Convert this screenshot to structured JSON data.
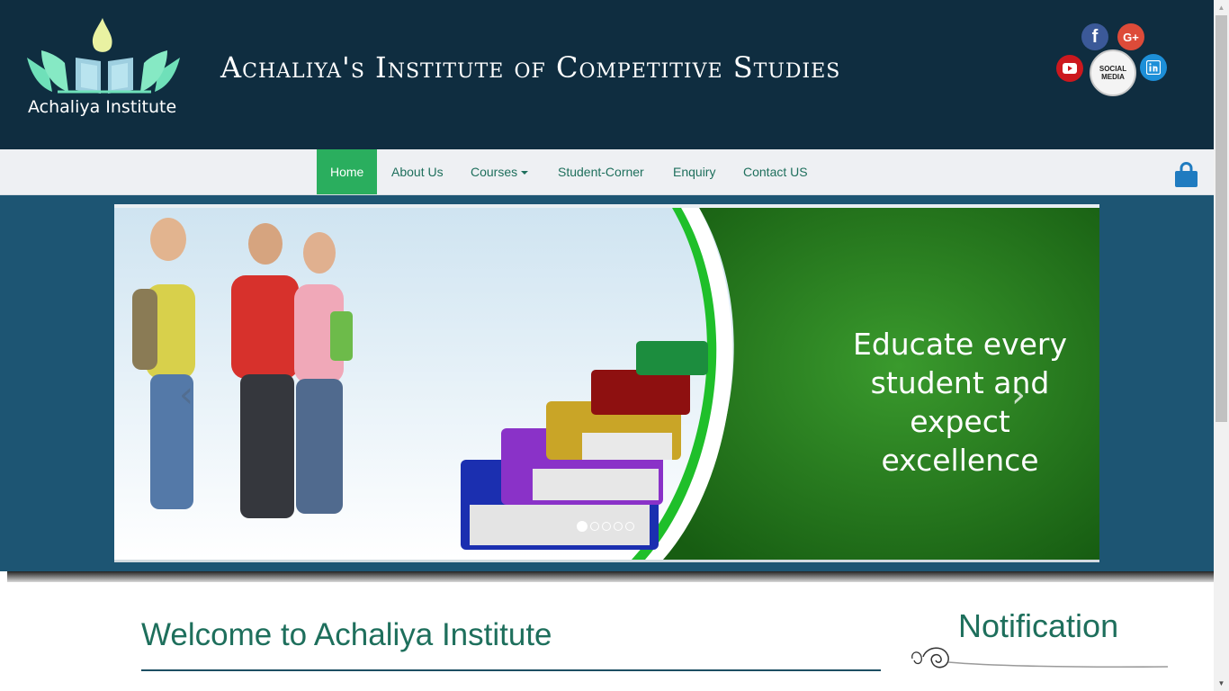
{
  "header": {
    "logo_text": "Achaliya Institute",
    "title": "Achaliya's Institute of Competitive Studies",
    "social": {
      "facebook": "f",
      "googleplus": "G+",
      "social_media_line1": "SOCIAL",
      "social_media_line2": "MEDIA"
    }
  },
  "nav": {
    "items": [
      {
        "label": "Home"
      },
      {
        "label": "About Us"
      },
      {
        "label": "Courses"
      },
      {
        "label": "Student-Corner"
      },
      {
        "label": "Enquiry"
      },
      {
        "label": "Contact US"
      }
    ],
    "active": "Home",
    "icons": [
      "cart-icon"
    ]
  },
  "carousel": {
    "slide_text": "Educate every student and expect excellence",
    "slide_count": 5,
    "current_slide": 1
  },
  "content": {
    "welcome_title": "Welcome to Achaliya Institute",
    "notification_title": "Notification"
  },
  "colors": {
    "header_bg": "#0f2d40",
    "nav_bg": "#eef0f3",
    "active_nav": "#2aae5e",
    "accent_text": "#1e6f5c",
    "banner_bg": "#1d5573"
  }
}
